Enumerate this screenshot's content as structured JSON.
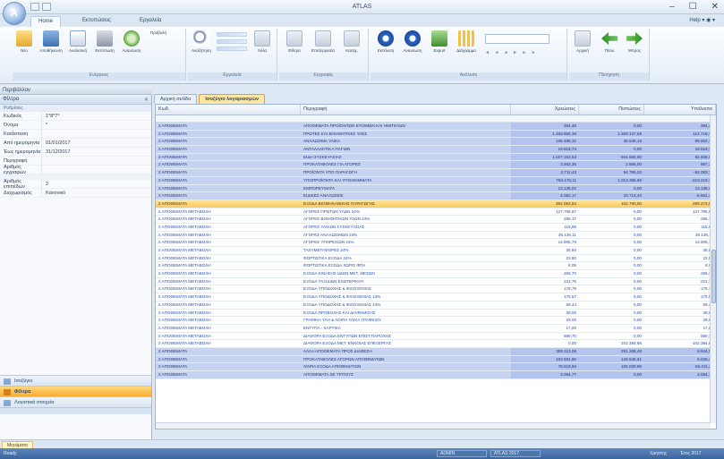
{
  "window": {
    "title": "ATLAS",
    "logo_letter": "A",
    "minimize": "–",
    "maximize": "☐",
    "close": "✕"
  },
  "ribbon_tabs": [
    "Home",
    "Εκτυπώσεις",
    "Εργαλεία"
  ],
  "help_text": "Help ▾ ◉ ▾",
  "ribbon": {
    "buttons_group1": [
      "Νέο",
      "Αποθήκευση",
      "Αναλυτική",
      "Εκτύπωση",
      "Ανανέωση",
      "Προβολή"
    ],
    "group1_label": "Ενέργειες",
    "buttons_group2": [
      "Αναζήτηση",
      "Προβολή",
      "Άλλα"
    ],
    "group2_label": "Εργαλεία",
    "buttons_group3": [
      "Φίλτρα",
      "Επεξεργασία",
      "Καταχ."
    ],
    "group3_label": "Εγγραφές",
    "buttons_group4": [
      "Εκτέλεση",
      "Ανανέωση",
      "Export",
      "Διάγραμμα"
    ],
    "group4_label": "Ανάλυση",
    "nav_strip": "◄ ◄ ◄ ► ► ►",
    "buttons_group5": [
      "Αρχική",
      "Πίσω",
      "Μπρος"
    ],
    "group5_label": "Πλοήγηση"
  },
  "workspace_title": "Περιβάλλον",
  "doc_tabs": [
    "Αρχική σελίδα",
    "Ισοζύγιο λογαριασμών"
  ],
  "left_panel": {
    "header": "Φίλτρα",
    "close": "✕",
    "section": "Ρυθμίσεις",
    "props1": [
      {
        "k": "Κωδικός",
        "v": "1*8*7*"
      },
      {
        "k": "Όνομα",
        "v": "*"
      },
      {
        "k": "Κατάσταση",
        "v": ""
      },
      {
        "k": "Από ημερομηνία",
        "v": "01/01/2017"
      },
      {
        "k": "Έως ημερομηνία",
        "v": "31/12/2017"
      },
      {
        "k": "Περιγραφή",
        "v": ""
      },
      {
        "k": "Αριθμός εγγραφών",
        "v": ""
      }
    ],
    "props2": [
      {
        "k": "Αριθμός επιπέδων",
        "v": "2"
      },
      {
        "k": "Διαχωρισμός",
        "v": "Κανονικό"
      }
    ],
    "nav": [
      "Ισοζύγιο",
      "Φίλτρα",
      "Λογιστικά στοιχεία"
    ]
  },
  "grid": {
    "headers": [
      "Κωδ.",
      "Περιγραφή",
      "Χρεώσεις",
      "Πιστώσεις",
      "Υπόλοιπο"
    ],
    "rows": [
      {
        "lvl": "lvl0",
        "code": "2 ΑΠΟΘΕΜΑΤΑ",
        "desc": "ΑΠΟΘΕΜΑΤΑ ΠΡΟΪΟΝΤΩΝ ΕΤΟΙΜΩΝ ΚΑΙ ΗΜΙΤΕΛΩΝ",
        "a": "394,48",
        "b": "0,00",
        "c": "394,48"
      },
      {
        "lvl": "lvl0",
        "code": "2 ΑΠΟΘΕΜΑΤΑ",
        "desc": "ΠΡΩΤΕΣ ΚΑΙ ΒΟΗΘΗΤΙΚΕΣ ΥΛΕΣ",
        "a": "1.483.856,36",
        "b": "1.369.137,58",
        "c": "114.718,78"
      },
      {
        "lvl": "lvl0",
        "code": "2 ΑΠΟΘΕΜΑΤΑ",
        "desc": "ΑΝΑΛΩΣΙΜΑ ΥΛΙΚΑ",
        "a": "136.498,32",
        "b": "46.546,15",
        "c": "89.952,17"
      },
      {
        "lvl": "lvl0",
        "code": "2 ΑΠΟΘΕΜΑΤΑ",
        "desc": "ΑΝΤΑΛΛΑΚΤΙΚΑ ΠΑΓΙΩΝ",
        "a": "19.819,74",
        "b": "0,00",
        "c": "19.819,74"
      },
      {
        "lvl": "lvl0",
        "code": "2 ΑΠΟΘΕΜΑΤΑ",
        "desc": "ΕΙΔΗ ΣΥΣΚΕΥΑΣΙΑΣ",
        "a": "1.037.163,53",
        "b": "944.656,90",
        "c": "92.506,63"
      },
      {
        "lvl": "lvl0",
        "code": "2 ΑΠΟΘΕΜΑΤΑ",
        "desc": "ΠΡΟΚΑΤΑΒΟΛΕΣ ΓΙΑ ΑΓΟΡΕΣ",
        "a": "3.463,36",
        "b": "2.566,00",
        "c": "897,36"
      },
      {
        "lvl": "lvl0",
        "code": "2 ΑΠΟΘΕΜΑΤΑ",
        "desc": "ΠΡΟΪΟΝΤΑ ΥΠΟ ΠΑΡΑΓΩΓΗ",
        "a": "2.711,43",
        "b": "94.795,20",
        "c": "-92.083,77"
      },
      {
        "lvl": "lvl0",
        "code": "2 ΑΠΟΘΕΜΑΤΑ",
        "desc": "ΥΠΟΠΡΟΪΟΝΤΑ ΚΑΙ ΥΠΟΛΕΙΜΜΑΤΑ",
        "a": "794.176,11",
        "b": "1.013.395,86",
        "c": "-219.219,75"
      },
      {
        "lvl": "lvl0",
        "code": "2 ΑΠΟΘΕΜΑΤΑ",
        "desc": "ΕΜΠΟΡΕΥΜΑΤΑ",
        "a": "13.136,02",
        "b": "0,00",
        "c": "13.136,02"
      },
      {
        "lvl": "lvl0",
        "code": "2 ΑΠΟΘΕΜΑΤΑ",
        "desc": "ΕΙΔΙΚΕΣ ΑΝΑΛΩΣΕΙΣ",
        "a": "4.052,17",
        "b": "10.713,40",
        "c": "-6.661,23"
      },
      {
        "lvl": "sel",
        "code": "2 ΑΠΟΘΕΜΑΤΑ",
        "desc": "ΕΞΟΔΑ ΒΙΟΜΗΧΑΝΙΚΗΣ ΠΑΡΑΓΩΓΗΣ",
        "a": "392.063,04",
        "b": "102.790,00",
        "c": "289.273,04"
      },
      {
        "lvl": "lvl1",
        "code": "2 ΑΠΟΘΕΜΑΤΑ ΜΕΤΑΒΟΛΗ",
        "desc": "ΑΓΟΡΕΣ ΠΡΩΤΩΝ ΥΛΩΝ 24%",
        "a": "127.795,67",
        "b": "0,00",
        "c": "127.795,67"
      },
      {
        "lvl": "lvl1",
        "code": "2 ΑΠΟΘΕΜΑΤΑ ΜΕΤΑΒΟΛΗ",
        "desc": "ΑΓΟΡΕΣ ΒΟΗΘΗΤΙΚΩΝ ΥΛΩΝ 24%",
        "a": "285,17",
        "b": "0,00",
        "c": "285,17"
      },
      {
        "lvl": "lvl1",
        "code": "2 ΑΠΟΘΕΜΑΤΑ ΜΕΤΑΒΟΛΗ",
        "desc": "ΑΓΟΡΕΣ ΥΛΙΚΩΝ ΣΥΣΚΕΥΑΣΙΑΣ",
        "a": "115,98",
        "b": "0,00",
        "c": "115,98"
      },
      {
        "lvl": "lvl1",
        "code": "2 ΑΠΟΘΕΜΑΤΑ ΜΕΤΑΒΟΛΗ",
        "desc": "ΑΓΟΡΕΣ ΑΝΑΛΩΣΙΜΩΝ 24%",
        "a": "36.136,11",
        "b": "0,00",
        "c": "36.136,11"
      },
      {
        "lvl": "lvl1",
        "code": "2 ΑΠΟΘΕΜΑΤΑ ΜΕΤΑΒΟΛΗ",
        "desc": "ΑΓΟΡΕΣ ΥΠΗΡΕΣΙΩΝ 24%",
        "a": "14.905,78",
        "b": "0,00",
        "c": "14.905,78"
      },
      {
        "lvl": "lvl1",
        "code": "2 ΑΠΟΘΕΜΑΤΑ ΜΕΤΑΒΟΛΗ",
        "desc": "ΤΑΧΥΜΕΤΑΦΟΡΕΣ 24%",
        "a": "35,50",
        "b": "0,00",
        "c": "35,50"
      },
      {
        "lvl": "lvl1",
        "code": "2 ΑΠΟΘΕΜΑΤΑ ΜΕΤΑΒΟΛΗ",
        "desc": "ΦΟΡΤΩΤΙΚΑ ΕΞΟΔΑ 24%",
        "a": "22,50",
        "b": "0,00",
        "c": "22,50"
      },
      {
        "lvl": "lvl1",
        "code": "2 ΑΠΟΘΕΜΑΤΑ ΜΕΤΑΒΟΛΗ",
        "desc": "ΦΟΡΤΩΤΙΚΑ ΕΞΟΔΑ ΧΩΡΙΣ ΦΠΑ",
        "a": "8,05",
        "b": "0,00",
        "c": "8,05"
      },
      {
        "lvl": "lvl1",
        "code": "2 ΑΠΟΘΕΜΑΤΑ ΜΕΤΑΒΟΛΗ",
        "desc": "ΕΞΟΔΑ ΚΙΝΗΣΗΣ ΙΔΙΩΝ ΜΕΤ. ΜΕΣΩΝ",
        "a": "266,70",
        "b": "0,00",
        "c": "266,70"
      },
      {
        "lvl": "lvl1",
        "code": "2 ΑΠΟΘΕΜΑΤΑ ΜΕΤΑΒΟΛΗ",
        "desc": "ΕΞΟΔΑ ΤΑΞΙΔΙΩΝ ΕΣΩΤΕΡΙΚΟΥ",
        "a": "221,75",
        "b": "0,00",
        "c": "221,75"
      },
      {
        "lvl": "lvl1",
        "code": "2 ΑΠΟΘΕΜΑΤΑ ΜΕΤΑΒΟΛΗ",
        "desc": "ΕΞΟΔΑ ΥΠΟΔΟΧΗΣ & ΦΙΛΟΞΕΝΙΑΣ",
        "a": "178,79",
        "b": "0,00",
        "c": "178,79"
      },
      {
        "lvl": "lvl1",
        "code": "2 ΑΠΟΘΕΜΑΤΑ ΜΕΤΑΒΟΛΗ",
        "desc": "ΕΞΟΔΑ ΥΠΟΔΟΧΗΣ & ΦΙΛΟΞΕΝΙΑΣ 13%",
        "a": "175,57",
        "b": "0,00",
        "c": "175,57"
      },
      {
        "lvl": "lvl1",
        "code": "2 ΑΠΟΘΕΜΑΤΑ ΜΕΤΑΒΟΛΗ",
        "desc": "ΕΞΟΔΑ ΥΠΟΔΟΧΗΣ & ΦΙΛΟΞΕΝΙΑΣ 24%",
        "a": "59,44",
        "b": "0,00",
        "c": "59,44"
      },
      {
        "lvl": "lvl1",
        "code": "2 ΑΠΟΘΕΜΑΤΑ ΜΕΤΑΒΟΛΗ",
        "desc": "ΕΞΟΔΑ ΠΡΟΒΟΛΗΣ ΚΑΙ ΔΙΑΦΗΜΙΣΗΣ",
        "a": "39,00",
        "b": "0,00",
        "c": "39,00"
      },
      {
        "lvl": "lvl1",
        "code": "2 ΑΠΟΘΕΜΑΤΑ ΜΕΤΑΒΟΛΗ",
        "desc": "ΓΡΑΦΙΚΗ ΥΛΗ & ΛΟΙΠΑ ΥΛΙΚΑ ΓΡΑΦΕΙΟΥ",
        "a": "29,00",
        "b": "0,00",
        "c": "29,00"
      },
      {
        "lvl": "lvl1",
        "code": "2 ΑΠΟΘΕΜΑΤΑ ΜΕΤΑΒΟΛΗ",
        "desc": "ΕΝΤΥΠΑ - ΧΑΡΤΙΚΑ",
        "a": "17,00",
        "b": "0,00",
        "c": "17,00"
      },
      {
        "lvl": "lvl1",
        "code": "2 ΑΠΟΘΕΜΑΤΑ ΜΕΤΑΒΟΛΗ",
        "desc": "ΔΙΑΦΟΡΑ ΕΞΟΔΑ ΕΝΤΥΠΩΝ ΕΠΙΣΤ.ΠΑΡΟΧΗΣ",
        "a": "590,70",
        "b": "0,00",
        "c": "590,70"
      },
      {
        "lvl": "lvl1",
        "code": "2 ΑΠΟΘΕΜΑΤΑ ΜΕΤΑΒΟΛΗ",
        "desc": "ΔΙΑΦΟΡΑ ΕΞΟΔΑ ΜΕΤ. ΕΝΝΟΙΑΣ ΕΠΕΞΕΡΓΑΣ",
        "a": "0,00",
        "b": "102.384,88",
        "c": "-102.384,88"
      },
      {
        "lvl": "lvl0",
        "code": "2 ΑΠΟΘΕΜΑΤΑ",
        "desc": "ΑΛΛΑ ΑΠΟΘΕΜΑΤΑ ΠΡΟΣ ΔΙΑΘΕΣΗ",
        "a": "300.113,06",
        "b": "291.268,48",
        "c": "8.844,58"
      },
      {
        "lvl": "lvl0",
        "code": "2 ΑΠΟΘΕΜΑΤΑ",
        "desc": "ΠΡΟΚΑΤΑΒΟΛΕΣ ΑΓΟΡΩΝ ΑΠΟΘΕΜΑΤΩΝ",
        "a": "153.591,86",
        "b": "148.546,61",
        "c": "5.045,25"
      },
      {
        "lvl": "lvl0",
        "code": "2 ΑΠΟΘΕΜΑΤΑ",
        "desc": "ΛΟΙΠΑ ΕΞΟΔΑ ΑΠΟΘΕΜΑΤΩΝ",
        "a": "78.619,66",
        "b": "105.030,89",
        "c": "-26.411,23"
      },
      {
        "lvl": "lvl0",
        "code": "2 ΑΠΟΘΕΜΑΤΑ",
        "desc": "ΑΠΟΘΕΜΑΤΑ ΣΕ ΤΡΙΤΟΥΣ",
        "a": "3.064,77",
        "b": "0,00",
        "c": "3.064,77"
      }
    ]
  },
  "message_tab": "Μηνύματα",
  "status": {
    "left": "Ready",
    "box1": "ADMIN",
    "box2": "ATLAS 2017",
    "right1": "Χρήστης",
    "right2": "Έτος 2017"
  }
}
